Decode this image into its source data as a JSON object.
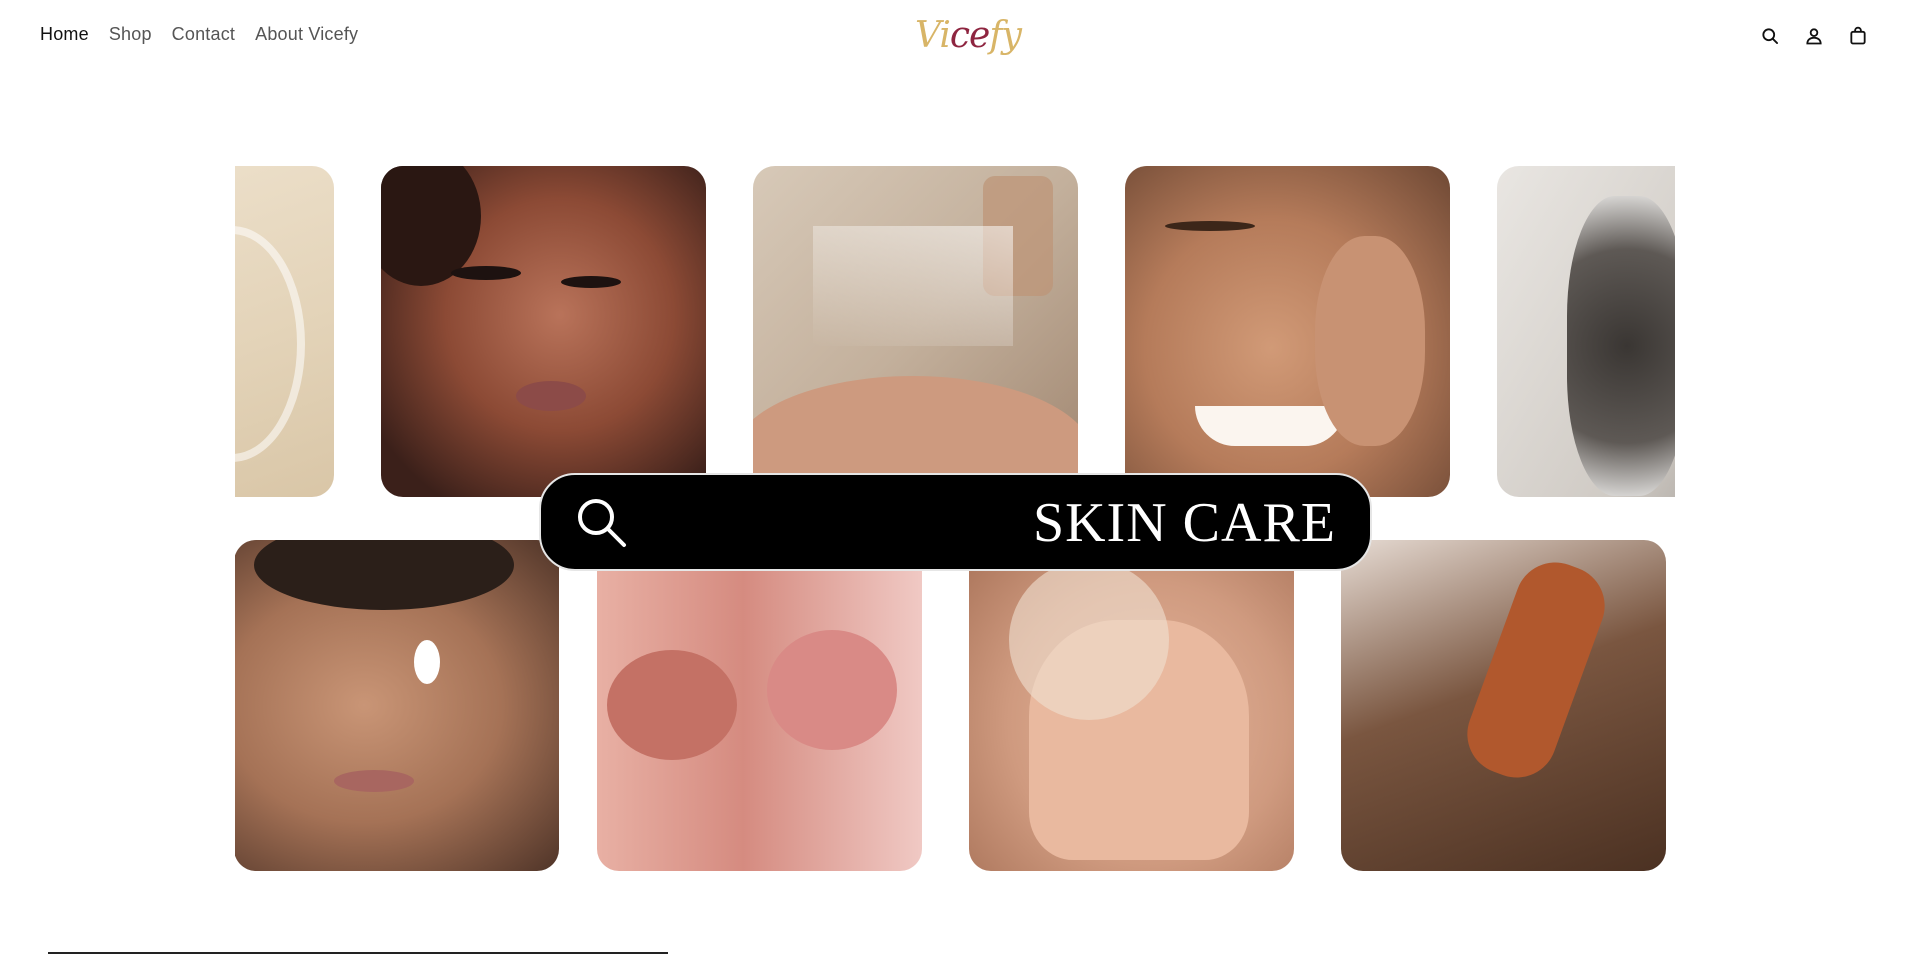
{
  "nav": {
    "items": [
      {
        "label": "Home",
        "active": true
      },
      {
        "label": "Shop",
        "active": false
      },
      {
        "label": "Contact",
        "active": false
      },
      {
        "label": "About Vicefy",
        "active": false
      }
    ]
  },
  "logo": {
    "part1": "Vi",
    "part2": "ce",
    "part3": "fy"
  },
  "header_icons": [
    "search-icon",
    "account-icon",
    "cart-icon"
  ],
  "hero": {
    "search_label": "SKIN CARE",
    "tiles": [
      {
        "name": "cream-swatch"
      },
      {
        "name": "woman-eyeliner-portrait"
      },
      {
        "name": "perfume-spray"
      },
      {
        "name": "man-smiling-skincare"
      },
      {
        "name": "hair-washing-foam"
      },
      {
        "name": "man-applying-cream"
      },
      {
        "name": "glossy-lips"
      },
      {
        "name": "body-scrub"
      },
      {
        "name": "hair-brushing"
      }
    ]
  },
  "colors": {
    "logo_gold": "#d8b567",
    "logo_burgundy": "#8e2540",
    "bar_background": "#000000",
    "bar_text": "#ffffff"
  }
}
